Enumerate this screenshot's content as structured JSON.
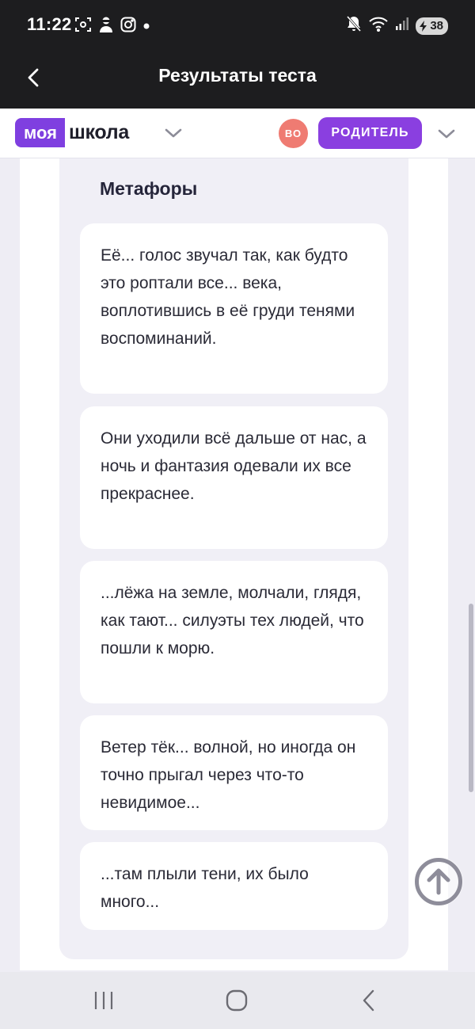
{
  "status_bar": {
    "time": "11:22",
    "battery": "38",
    "left_icons": [
      "screenshot-icon",
      "person-icon",
      "instagram-icon",
      "dot-icon"
    ],
    "right_icons": [
      "mute-icon",
      "wifi-icon",
      "signal-icon",
      "battery-icon"
    ]
  },
  "app_bar": {
    "title": "Результаты теста"
  },
  "school_header": {
    "logo_badge": "моя",
    "logo_text": "школа",
    "avatar_initials": "ВО",
    "role": "РОДИТЕЛЬ"
  },
  "section": {
    "title": "Метафоры",
    "cards": [
      {
        "text": "Её... голос звучал так, как будто это роптали все... века, воплотившись в её груди тенями воспоминаний."
      },
      {
        "text": "Они уходили всё дальше от нас, а ночь и фантазия одевали их все прекраснее."
      },
      {
        "text": "...лёжа на земле, молчали, глядя, как тают... силуэты тех людей, что пошли к морю."
      },
      {
        "text": "Ветер тёк... волной, но иногда он точно прыгал через что-то невидимое..."
      },
      {
        "text": "...там плыли тени, их было много..."
      }
    ]
  },
  "colors": {
    "brand_purple": "#7f3fe0",
    "avatar_coral": "#ef7b72",
    "dark_bar": "#1d1d1f",
    "page_bg": "#eeedf4"
  }
}
